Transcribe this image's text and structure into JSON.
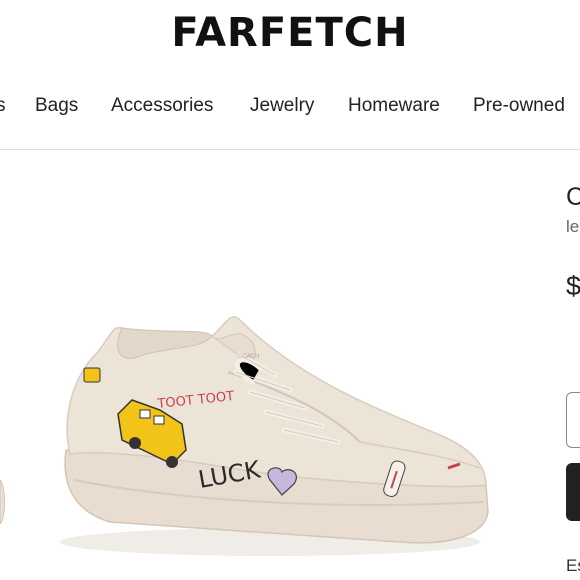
{
  "header": {
    "logo": "FARFETCH"
  },
  "nav": {
    "items": [
      {
        "label": "s"
      },
      {
        "label": "Bags"
      },
      {
        "label": "Accessories"
      },
      {
        "label": "Jewelry"
      },
      {
        "label": "Homeware"
      },
      {
        "label": "Pre-owned"
      }
    ]
  },
  "product": {
    "image_alt_icon": "sneaker-image",
    "shoe_doodles": [
      "TOOT TOOT",
      "LUCK"
    ],
    "title_partial": "C",
    "subtitle_partial": "le",
    "price_partial": "$",
    "footnote_partial": "Es"
  },
  "colors": {
    "shoe_body": "#ede4d8",
    "sole": "#e8ddd0",
    "taxi": "#f2c318",
    "button_dark": "#222222"
  }
}
